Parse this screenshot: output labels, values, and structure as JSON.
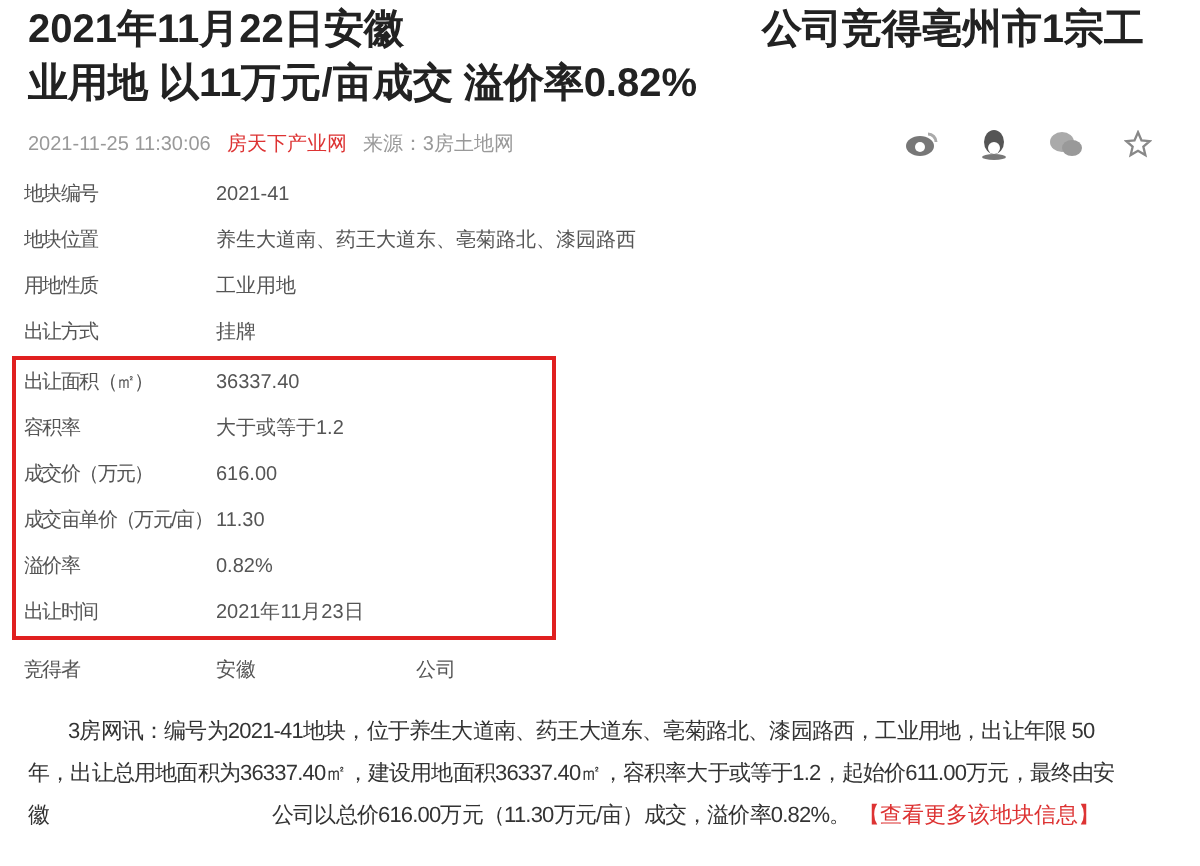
{
  "title": {
    "line1_left": "2021年11月22日安徽",
    "line1_right": "公司竞得亳州市1宗工",
    "line2": "业用地 以11万元/亩成交 溢价率0.82%"
  },
  "meta": {
    "time": "2021-11-25 11:30:06",
    "site": "房天下产业网",
    "source": "来源：3房土地网"
  },
  "rows": [
    {
      "label": "地块编号",
      "value": "2021-41",
      "highlighted": false
    },
    {
      "label": "地块位置",
      "value": "养生大道南、药王大道东、亳菊路北、漆园路西",
      "highlighted": false
    },
    {
      "label": "用地性质",
      "value": "工业用地",
      "highlighted": false
    },
    {
      "label": "出让方式",
      "value": "挂牌",
      "highlighted": false
    },
    {
      "label": "出让面积（㎡）",
      "value": "36337.40",
      "highlighted": true
    },
    {
      "label": "容积率",
      "value": "大于或等于1.2",
      "highlighted": true
    },
    {
      "label": "成交价（万元）",
      "value": "616.00",
      "highlighted": true
    },
    {
      "label": "成交亩单价（万元/亩）",
      "value": "11.30",
      "highlighted": true
    },
    {
      "label": "溢价率",
      "value": "0.82%",
      "highlighted": true
    },
    {
      "label": "出让时间",
      "value": "2021年11月23日",
      "highlighted": true
    }
  ],
  "winner": {
    "label": "竞得者",
    "value_left": "安徽",
    "value_right": "公司"
  },
  "paragraph": {
    "line1": "3房网讯：编号为2021-41地块，位于养生大道南、药王大道东、亳菊路北、漆园路西，工业用地，出让年限 50",
    "line2": "年，出让总用地面积为36337.40㎡，建设用地面积36337.40㎡，容积率大于或等于1.2，起始价611.00万元，最终由安",
    "line3_left": "徽",
    "line3_right": "公司以总价616.00万元（11.30万元/亩）成交，溢价率0.82%。",
    "link": "【查看更多该地块信息】"
  }
}
